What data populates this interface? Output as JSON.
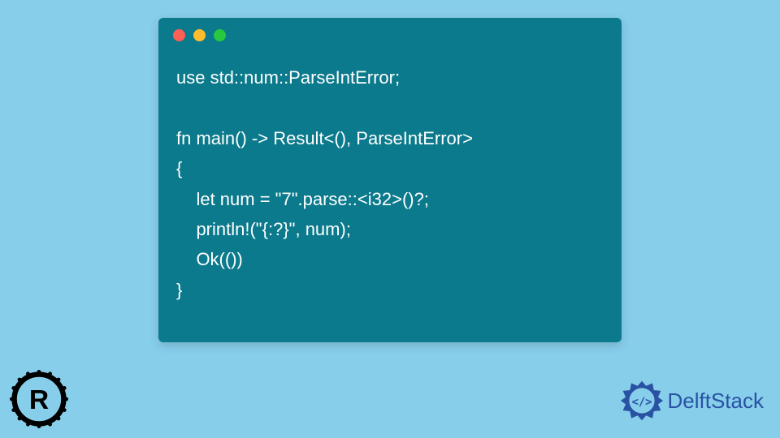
{
  "code": {
    "lines": [
      "use std::num::ParseIntError;",
      "",
      "fn main() -> Result<(), ParseIntError>",
      "{",
      "    let num = \"7\".parse::<i32>()?;",
      "    println!(\"{:?}\", num);",
      "    Ok(())",
      "}"
    ]
  },
  "window": {
    "dot_colors": {
      "red": "#ff5f56",
      "yellow": "#ffbd2e",
      "green": "#27c93f"
    }
  },
  "branding": {
    "name": "DelftStack",
    "color": "#2952a3"
  },
  "colors": {
    "background": "#87ceeb",
    "code_bg": "#0b7a8c",
    "code_text": "#ffffff"
  }
}
